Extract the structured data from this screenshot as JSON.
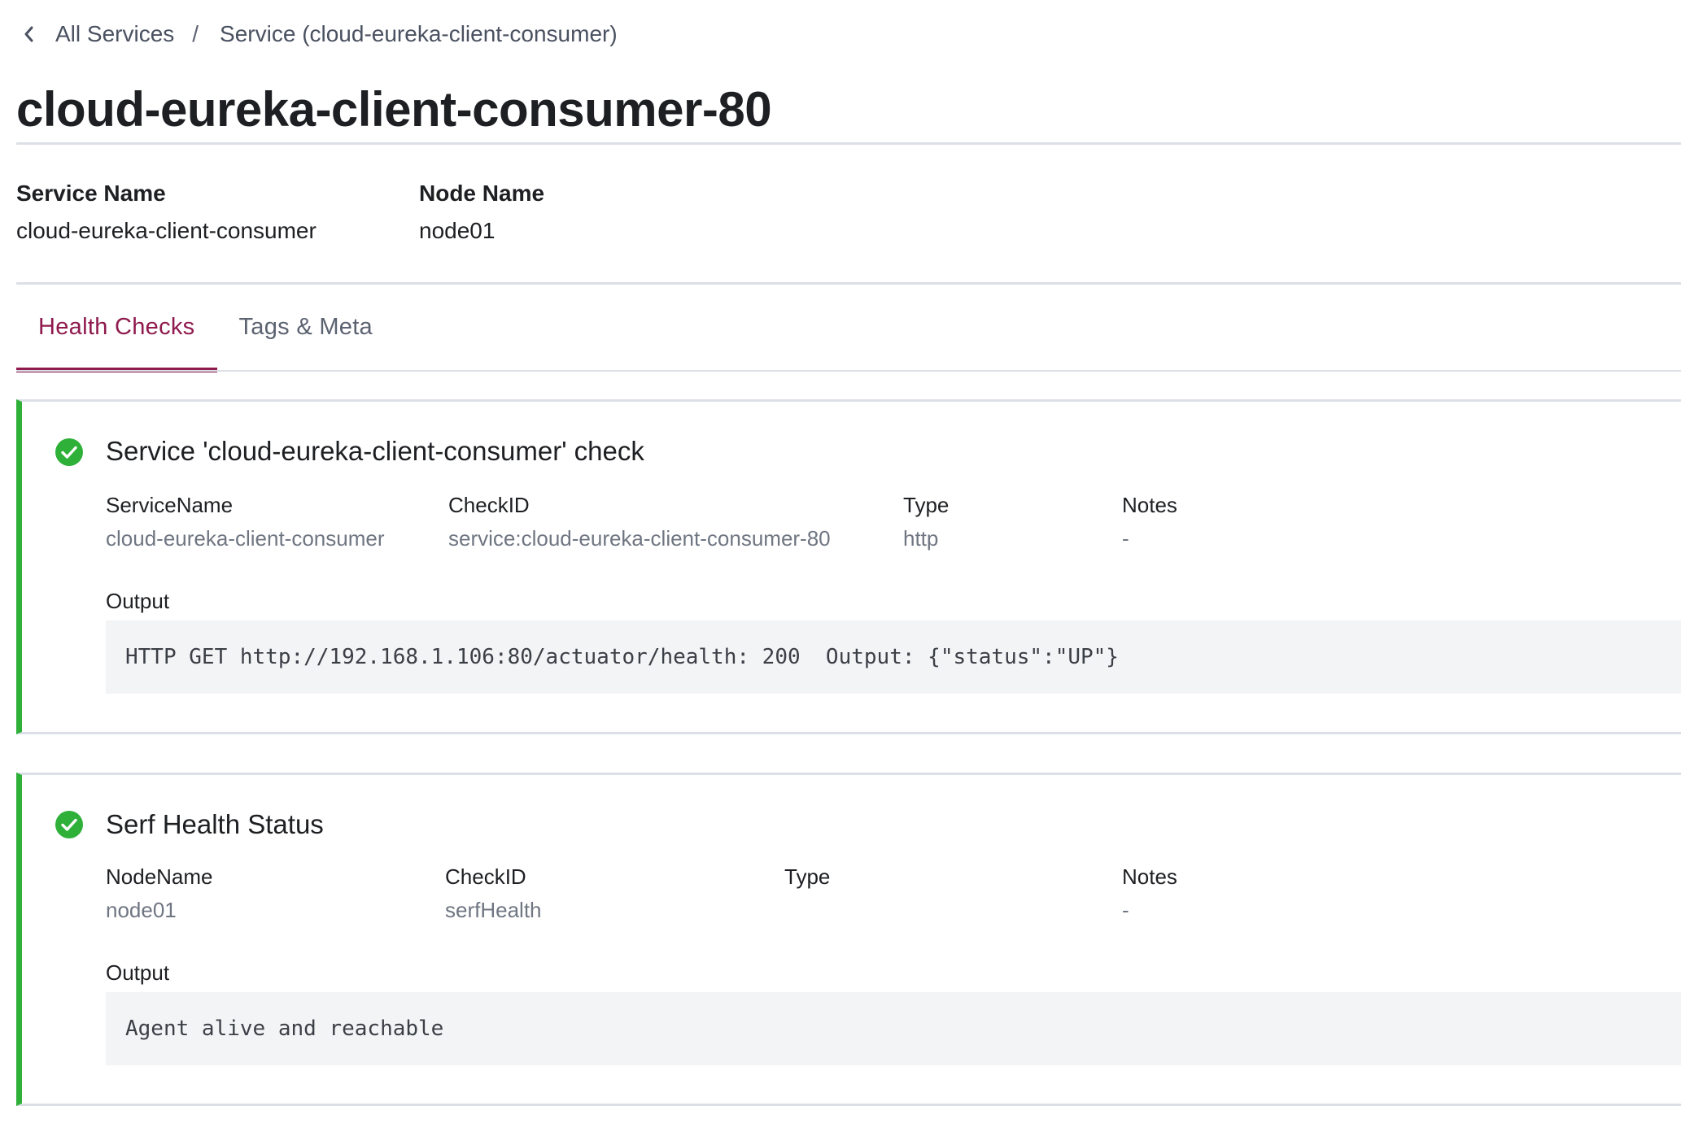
{
  "breadcrumb": {
    "back_label": "All Services",
    "separator": "/",
    "current": "Service (cloud-eureka-client-consumer)"
  },
  "page_title": "cloud-eureka-client-consumer-80",
  "info": {
    "service_name_label": "Service Name",
    "service_name_value": "cloud-eureka-client-consumer",
    "node_name_label": "Node Name",
    "node_name_value": "node01"
  },
  "tabs": [
    {
      "label": "Health Checks",
      "active": true
    },
    {
      "label": "Tags & Meta",
      "active": false
    }
  ],
  "colors": {
    "accent": "#8f1a4d",
    "passing": "#2eb039",
    "border": "#dce0e6"
  },
  "checks": [
    {
      "status_icon": "check-circle-icon",
      "title": "Service 'cloud-eureka-client-consumer' check",
      "fields": [
        {
          "label": "ServiceName",
          "value": "cloud-eureka-client-consumer"
        },
        {
          "label": "CheckID",
          "value": "service:cloud-eureka-client-consumer-80"
        },
        {
          "label": "Type",
          "value": "http"
        },
        {
          "label": "Notes",
          "value": "-"
        }
      ],
      "output_label": "Output",
      "output": "HTTP GET http://192.168.1.106:80/actuator/health: 200  Output: {\"status\":\"UP\"}"
    },
    {
      "status_icon": "check-circle-icon",
      "title": "Serf Health Status",
      "fields": [
        {
          "label": "NodeName",
          "value": "node01"
        },
        {
          "label": "CheckID",
          "value": "serfHealth"
        },
        {
          "label": "Type",
          "value": ""
        },
        {
          "label": "Notes",
          "value": "-"
        }
      ],
      "output_label": "Output",
      "output": "Agent alive and reachable"
    }
  ]
}
